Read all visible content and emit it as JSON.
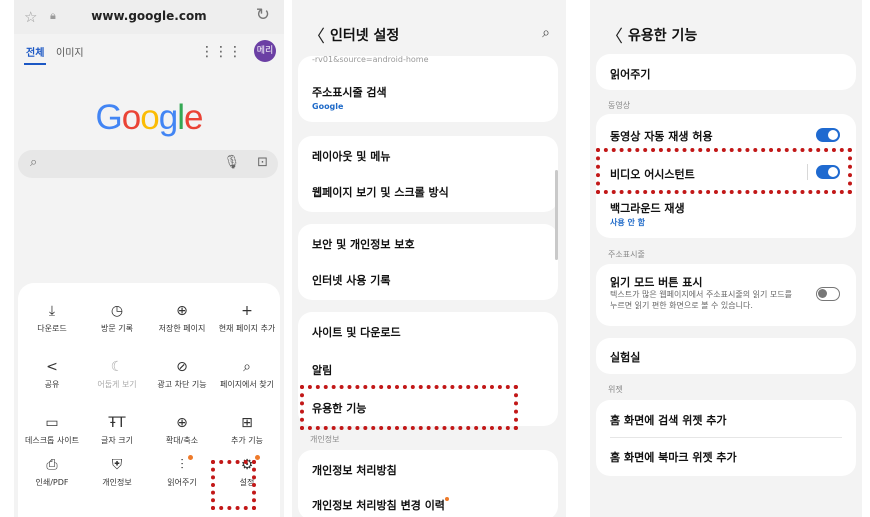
{
  "browser": {
    "url": "www.google.com",
    "tabs": [
      "전체",
      "이미지"
    ],
    "avatar": "메리",
    "logo": [
      {
        "ch": "G",
        "color": "#4285F4"
      },
      {
        "ch": "o",
        "color": "#EA4335"
      },
      {
        "ch": "o",
        "color": "#FBBC05"
      },
      {
        "ch": "g",
        "color": "#4285F4"
      },
      {
        "ch": "l",
        "color": "#34A853"
      },
      {
        "ch": "e",
        "color": "#EA4335"
      }
    ],
    "menu": [
      {
        "icon": "download-icon",
        "glyph": "⤓",
        "label": "다운로드"
      },
      {
        "icon": "history-icon",
        "glyph": "◷",
        "label": "방문 기록"
      },
      {
        "icon": "globe-icon",
        "glyph": "⊕",
        "label": "저장한 페이지"
      },
      {
        "icon": "plus-icon",
        "glyph": "+",
        "label": "현재 페이지 추가"
      },
      {
        "icon": "share-icon",
        "glyph": "<",
        "label": "공유"
      },
      {
        "icon": "moon-icon",
        "glyph": "☾",
        "label": "어둡게 보기"
      },
      {
        "icon": "block-icon",
        "glyph": "⊘",
        "label": "광고 차단 기능"
      },
      {
        "icon": "find-in-page-icon",
        "glyph": "⌕",
        "label": "페이지에서 찾기"
      },
      {
        "icon": "desktop-icon",
        "glyph": "▭",
        "label": "데스크톱 사이트"
      },
      {
        "icon": "text-size-icon",
        "glyph": "ŦT",
        "label": "글자 크기"
      },
      {
        "icon": "zoom-icon",
        "glyph": "⊕",
        "label": "확대/축소"
      },
      {
        "icon": "add-feature-icon",
        "glyph": "⊞",
        "label": "추가 기능"
      },
      {
        "icon": "print-icon",
        "glyph": "⎙",
        "label": "인쇄/PDF"
      },
      {
        "icon": "privacy-icon",
        "glyph": "⛨",
        "label": "개인정보"
      },
      {
        "icon": "read-aloud-icon",
        "glyph": "⫶",
        "label": "읽어주기"
      },
      {
        "icon": "settings-icon",
        "glyph": "⚙",
        "label": "설정"
      }
    ]
  },
  "internet_settings": {
    "title": "인터넷 설정",
    "partial_text": "-rv01&source=android-home",
    "address_bar_search": "주소표시줄 검색",
    "address_bar_search_value": "Google",
    "layout_menu": "레이아웃 및 메뉴",
    "page_view_scroll": "웹페이지 보기 및 스크롤 방식",
    "security_privacy": "보안 및 개인정보 보호",
    "internet_history": "인터넷 사용 기록",
    "sites_downloads": "사이트 및 다운로드",
    "notifications": "알림",
    "useful_features": "유용한 기능",
    "privacy_section": "개인정보",
    "privacy_policy": "개인정보 처리방침",
    "privacy_policy_changes": "개인정보 처리방침 변경 이력"
  },
  "useful_features": {
    "title": "유용한 기능",
    "read_aloud": "읽어주기",
    "video_section": "동영상",
    "video_autoplay": "동영상 자동 재생 허용",
    "video_autoplay_on": true,
    "video_assistant": "비디오 어시스턴트",
    "video_assistant_on": true,
    "background_play": "백그라운드 재생",
    "background_play_value": "사용 안 함",
    "address_bar_section": "주소표시줄",
    "reader_mode_button": "읽기 모드 버튼 표시",
    "reader_mode_desc": "텍스트가 많은 웹페이지에서 주소표시줄의 읽기 모드를 누르면 읽기 편한 화면으로 볼 수 있습니다.",
    "reader_mode_on": false,
    "labs": "실험실",
    "widget_section": "위젯",
    "add_search_widget": "홈 화면에 검색 위젯 추가",
    "add_bookmark_widget": "홈 화면에 북마크 위젯 추가"
  },
  "colors": {
    "accent_blue": "#1f6ad0",
    "highlight_red": "#c21818",
    "notify_dot": "#ee7a2a"
  }
}
